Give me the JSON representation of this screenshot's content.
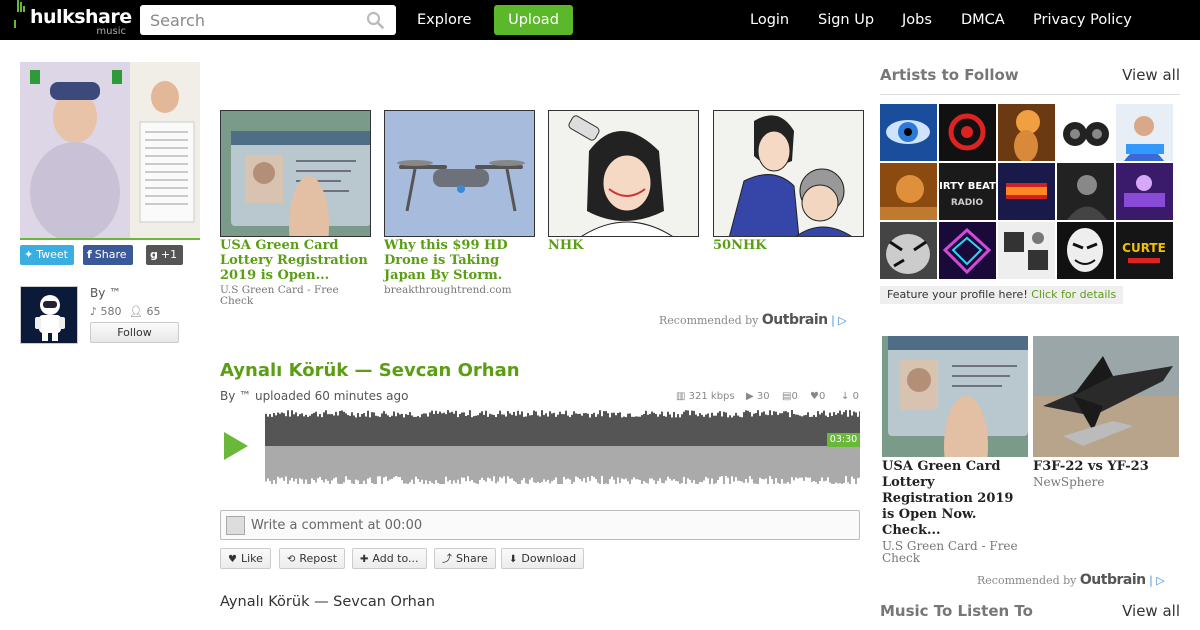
{
  "header": {
    "logo_text": "hulkshare",
    "logo_sub": "music",
    "search_placeholder": "Search",
    "nav_explore": "Explore",
    "nav_upload": "Upload",
    "nav_login": "Login",
    "nav_signup": "Sign Up",
    "nav_jobs": "Jobs",
    "nav_dmca": "DMCA",
    "nav_privacy": "Privacy Policy"
  },
  "social": {
    "tweet": "Tweet",
    "share": "Share",
    "plus": "+1"
  },
  "uploader": {
    "by": "By ™",
    "plays": "580",
    "followers": "65",
    "follow_label": "Follow"
  },
  "recommended": {
    "items": [
      {
        "title": "USA Green Card Lottery Registration 2019 is Open...",
        "source": "U.S Green Card - Free Check"
      },
      {
        "title": "Why this $99 HD Drone is Taking Japan By Storm.",
        "source": "breakthroughtrend.com"
      },
      {
        "title": "NHK",
        "source": ""
      },
      {
        "title": "50NHK",
        "source": ""
      }
    ],
    "by_label": "Recommended by",
    "brand": "Outbrain"
  },
  "track": {
    "title": "Aynalı Körük — Sevcan Orhan",
    "by_line": "By ™ uploaded 60 minutes ago",
    "bitrate": "321 kbps",
    "plays": "30",
    "comments": "0",
    "likes": "0",
    "downloads": "0",
    "duration": "03:30",
    "comment_placeholder": "Write a comment at 00:00",
    "actions": {
      "like": "Like",
      "repost": "Repost",
      "add_to": "Add to...",
      "share": "Share",
      "download": "Download"
    },
    "description": "Aynalı Körük — Sevcan Orhan"
  },
  "sidebar": {
    "artists_heading": "Artists to Follow",
    "view_all": "View all",
    "feature_text": "Feature your profile here!",
    "feature_link": "Click for details",
    "ads": [
      {
        "title": "USA Green Card Lottery Registration 2019 is Open Now. Check...",
        "source": "U.S Green Card - Free Check"
      },
      {
        "title": "F3F-22 vs YF-23",
        "source": "NewSphere"
      }
    ],
    "rec_by_label": "Recommended by",
    "rec_brand": "Outbrain",
    "music_heading": "Music To Listen To",
    "music_view_all": "View all",
    "artist_tile_text": {
      "dirty_beats": "DIRTY BEATS",
      "dirty_radio": "RADIO",
      "curte": "CURTE"
    }
  },
  "colors": {
    "brand_green": "#5cb82b",
    "link_green": "#5a9e14",
    "topbar": "#000000"
  }
}
